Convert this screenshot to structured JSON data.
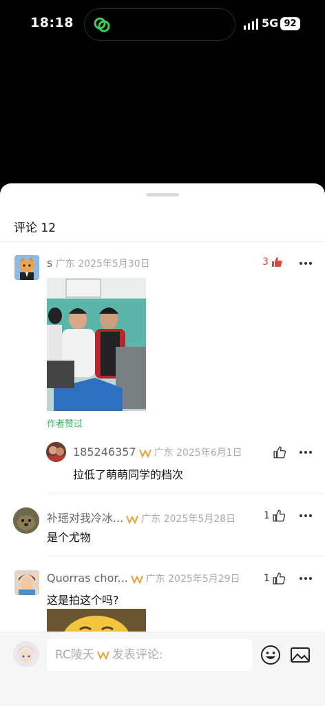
{
  "status_bar": {
    "time": "18:18",
    "network": "5G",
    "battery": "92"
  },
  "sheet": {
    "title": "评论 12"
  },
  "comments": [
    {
      "user": "s",
      "location": "广东",
      "date": "2025年5月30日",
      "likes": "3",
      "author_liked": "作者赞过",
      "reply": {
        "user": "185246357",
        "location": "广东",
        "date": "2025年6月1日",
        "text": "拉低了萌萌同学的档次"
      }
    },
    {
      "user": "补瑶对我冷冰...",
      "location": "广东",
      "date": "2025年5月28日",
      "likes": "1",
      "text": "是个尤物"
    },
    {
      "user": "Quorras chor...",
      "location": "广东",
      "date": "2025年5月29日",
      "likes": "1",
      "text": "这是拍这个吗?"
    }
  ],
  "composer": {
    "placeholder_user": "RC陵天",
    "placeholder_text": "发表评论:"
  },
  "colors": {
    "like_active": "#e0463c",
    "author_liked": "#35b45a",
    "badge": "#e6a23c"
  }
}
